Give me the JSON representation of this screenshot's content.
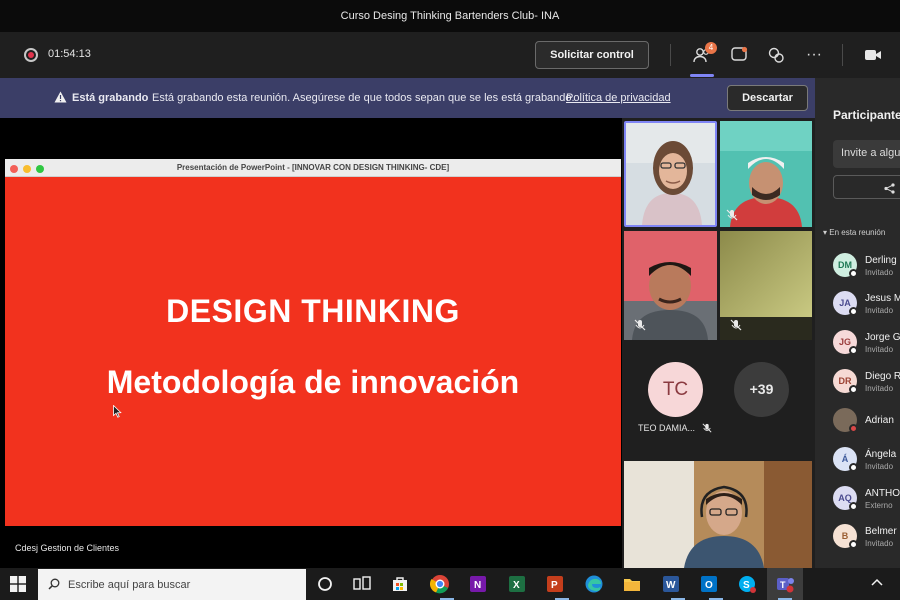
{
  "window": {
    "title": "Curso Desing Thinking Bartenders Club- INA"
  },
  "toolbar": {
    "timer": "01:54:13",
    "request_control_label": "Solicitar control",
    "participants_badge": "4",
    "more_label": "···"
  },
  "banner": {
    "strong": "Está grabando",
    "message": "Está grabando esta reunión. Asegúrese de que todos sepan que se les está grabando.",
    "link": "Política de privacidad",
    "discard_label": "Descartar"
  },
  "shared_screen": {
    "window_title": "Presentación de PowerPoint - [INNOVAR CON DESIGN THINKING- CDE]",
    "slide_title": "DESIGN THINKING",
    "slide_subtitle": "Metodología de innovación",
    "presenter": "Cdesj Gestion de Clientes"
  },
  "video": {
    "tc_initials": "TC",
    "tc_name": "TEO DAMIA...",
    "more_count": "+39"
  },
  "panel": {
    "title": "Participantes",
    "invite_placeholder": "Invite a alguien",
    "section_label": "En esta reunión",
    "participants": [
      {
        "initials": "DM",
        "name": "Derling",
        "role": "Invitado",
        "bg": "#cfeee0",
        "fg": "#1f7a55"
      },
      {
        "initials": "JA",
        "name": "Jesus M",
        "role": "Invitado",
        "bg": "#dcdcf2",
        "fg": "#4b4b8f"
      },
      {
        "initials": "JG",
        "name": "Jorge G",
        "role": "Invitado",
        "bg": "#f6d9d9",
        "fg": "#9b3d3d"
      },
      {
        "initials": "DR",
        "name": "Diego R",
        "role": "Invitado",
        "bg": "#f6dad4",
        "fg": "#9b4232"
      },
      {
        "initials": "",
        "name": "Adrian",
        "role": "",
        "bg": "#7a6a5a",
        "fg": "#ffffff"
      },
      {
        "initials": "Á",
        "name": "Ángela",
        "role": "Invitado",
        "bg": "#dbe3f5",
        "fg": "#3d5a9b"
      },
      {
        "initials": "AQ",
        "name": "ANTHO",
        "role": "Externo",
        "bg": "#dcdcf2",
        "fg": "#4b4b8f"
      },
      {
        "initials": "B",
        "name": "Belmer",
        "role": "Invitado",
        "bg": "#f6e2d4",
        "fg": "#9b5d32"
      }
    ]
  },
  "taskbar": {
    "search_placeholder": "Escribe aquí para buscar"
  },
  "colors": {
    "banner": "#3b3e67",
    "slide": "#f2321e",
    "accent": "#7f85f5"
  }
}
